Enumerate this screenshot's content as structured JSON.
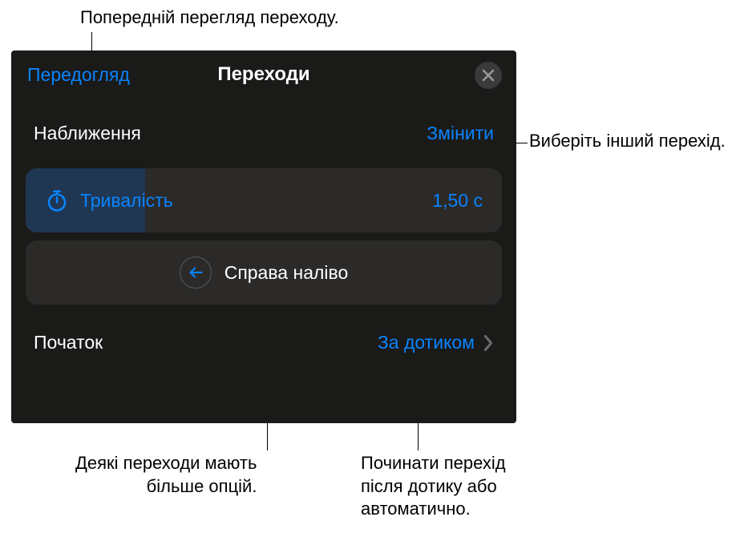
{
  "callouts": {
    "top": "Попередній перегляд переходу.",
    "right": "Виберіть інший перехід.",
    "bottom_left_l1": "Деякі переходи мають",
    "bottom_left_l2": "більше опцій.",
    "bottom_right_l1": "Починати перехід",
    "bottom_right_l2": "після дотику або",
    "bottom_right_l3": "автоматично."
  },
  "header": {
    "preview": "Передогляд",
    "title": "Переходи"
  },
  "section": {
    "name": "Наближення",
    "change": "Змінити"
  },
  "duration": {
    "label": "Тривалість",
    "value": "1,50 с"
  },
  "direction": {
    "label": "Справа наліво"
  },
  "start": {
    "label": "Початок",
    "value": "За дотиком"
  }
}
